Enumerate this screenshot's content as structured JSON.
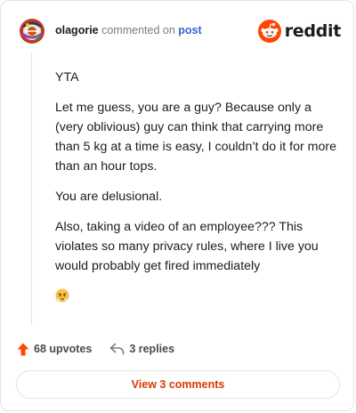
{
  "header": {
    "username": "olagorie",
    "action": "commented on",
    "post_link": "post",
    "logo_text": "reddit",
    "logo_icon": "reddit-snoo-icon"
  },
  "comment": {
    "paragraphs": [
      "YTA",
      "Let me guess, you are a guy? Because only a (very oblivious) guy can think that carrying more than 5 kg at a time is easy, I couldn’t do it for more than an hour tops.",
      "You are delusional.",
      "Also, taking a video of an employee??? This violates so many privacy rules, where I live you would probably get fired immediately"
    ],
    "emoji": "face-with-steam-emoji"
  },
  "footer": {
    "upvotes_label": "68 upvotes",
    "replies_label": "3 replies",
    "upvote_icon": "upvote-arrow-icon",
    "reply_icon": "reply-arrow-icon"
  },
  "view_button": {
    "label": "View 3 comments"
  },
  "colors": {
    "accent": "#d93a00",
    "upvote": "#ff4500",
    "link": "#3366cc"
  }
}
